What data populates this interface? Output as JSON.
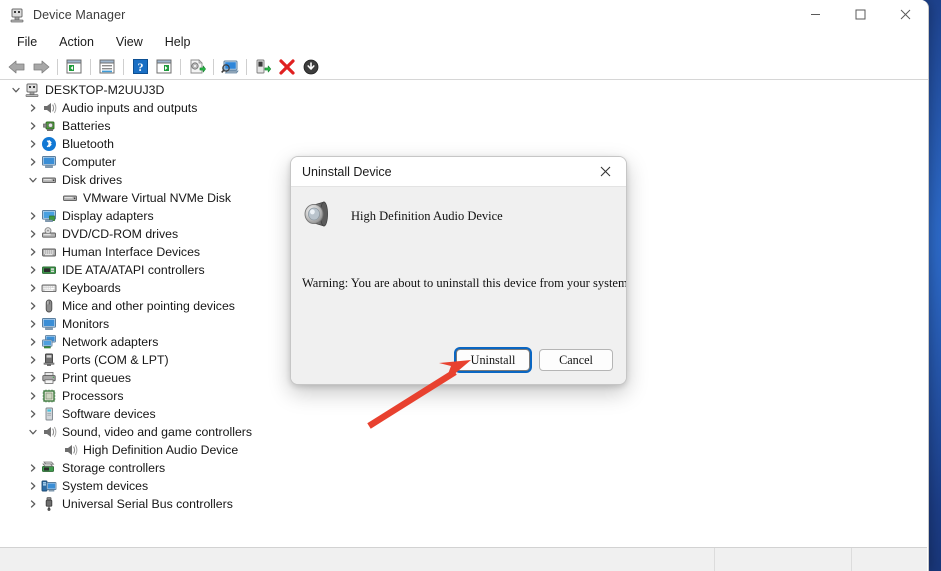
{
  "window": {
    "title": "Device Manager",
    "app_icon": "device-manager-icon",
    "controls": {
      "minimize": "minimize-icon",
      "maximize": "maximize-icon",
      "close": "close-icon"
    }
  },
  "menubar": {
    "items": [
      {
        "label": "File"
      },
      {
        "label": "Action"
      },
      {
        "label": "View"
      },
      {
        "label": "Help"
      }
    ]
  },
  "toolbar": {
    "buttons": [
      {
        "name": "back-icon"
      },
      {
        "name": "forward-icon"
      },
      {
        "name": "show-hide-console-tree-icon"
      },
      {
        "name": "properties-icon"
      },
      {
        "name": "help-icon"
      },
      {
        "name": "show-hide-action-pane-icon"
      },
      {
        "name": "update-driver-icon"
      },
      {
        "name": "scan-for-hardware-changes-icon"
      },
      {
        "name": "enable-device-icon"
      },
      {
        "name": "uninstall-device-icon"
      },
      {
        "name": "disable-device-icon"
      }
    ]
  },
  "tree": {
    "root": {
      "label": "DESKTOP-M2UUJ3D",
      "icon": "computer-root-icon",
      "expanded": true
    },
    "items": [
      {
        "label": "Audio inputs and outputs",
        "icon": "speaker-icon",
        "expanded": false,
        "indent": 1
      },
      {
        "label": "Batteries",
        "icon": "battery-icon",
        "expanded": false,
        "indent": 1
      },
      {
        "label": "Bluetooth",
        "icon": "bluetooth-icon",
        "expanded": false,
        "indent": 1
      },
      {
        "label": "Computer",
        "icon": "monitor-icon",
        "expanded": false,
        "indent": 1
      },
      {
        "label": "Disk drives",
        "icon": "disk-drive-icon",
        "expanded": true,
        "indent": 1
      },
      {
        "label": "VMware Virtual NVMe Disk",
        "icon": "disk-drive-icon",
        "expanded": null,
        "indent": 2
      },
      {
        "label": "Display adapters",
        "icon": "display-adapter-icon",
        "expanded": false,
        "indent": 1
      },
      {
        "label": "DVD/CD-ROM drives",
        "icon": "dvd-drive-icon",
        "expanded": false,
        "indent": 1
      },
      {
        "label": "Human Interface Devices",
        "icon": "hid-icon",
        "expanded": false,
        "indent": 1
      },
      {
        "label": "IDE ATA/ATAPI controllers",
        "icon": "ide-controller-icon",
        "expanded": false,
        "indent": 1
      },
      {
        "label": "Keyboards",
        "icon": "keyboard-icon",
        "expanded": false,
        "indent": 1
      },
      {
        "label": "Mice and other pointing devices",
        "icon": "mouse-icon",
        "expanded": false,
        "indent": 1
      },
      {
        "label": "Monitors",
        "icon": "monitor-icon",
        "expanded": false,
        "indent": 1
      },
      {
        "label": "Network adapters",
        "icon": "network-adapter-icon",
        "expanded": false,
        "indent": 1
      },
      {
        "label": "Ports (COM & LPT)",
        "icon": "port-icon",
        "expanded": false,
        "indent": 1
      },
      {
        "label": "Print queues",
        "icon": "printer-icon",
        "expanded": false,
        "indent": 1
      },
      {
        "label": "Processors",
        "icon": "processor-icon",
        "expanded": false,
        "indent": 1
      },
      {
        "label": "Software devices",
        "icon": "software-device-icon",
        "expanded": false,
        "indent": 1
      },
      {
        "label": "Sound, video and game controllers",
        "icon": "speaker-icon",
        "expanded": true,
        "indent": 1
      },
      {
        "label": "High Definition Audio Device",
        "icon": "speaker-icon",
        "expanded": null,
        "indent": 2
      },
      {
        "label": "Storage controllers",
        "icon": "storage-controller-icon",
        "expanded": false,
        "indent": 1
      },
      {
        "label": "System devices",
        "icon": "system-device-icon",
        "expanded": false,
        "indent": 1
      },
      {
        "label": "Universal Serial Bus controllers",
        "icon": "usb-icon",
        "expanded": false,
        "indent": 1
      }
    ]
  },
  "statusbar": {
    "cells": [
      "",
      "",
      ""
    ]
  },
  "dialog": {
    "title": "Uninstall Device",
    "close_icon": "close-icon",
    "device_icon": "speaker-icon",
    "device_name": "High Definition Audio Device",
    "warning": "Warning: You are about to uninstall this device from your system.",
    "buttons": [
      {
        "label": "Uninstall",
        "focused": true
      },
      {
        "label": "Cancel",
        "focused": false
      }
    ]
  },
  "annotation": {
    "type": "arrow",
    "color": "#e8412f",
    "points_to": "Uninstall"
  },
  "colors": {
    "accent_focus": "#0a66c2",
    "annotation_red": "#e8412f",
    "dialog_bg": "#f0f0f0",
    "window_bg": "#ffffff",
    "desktop": "#1c3d86"
  }
}
